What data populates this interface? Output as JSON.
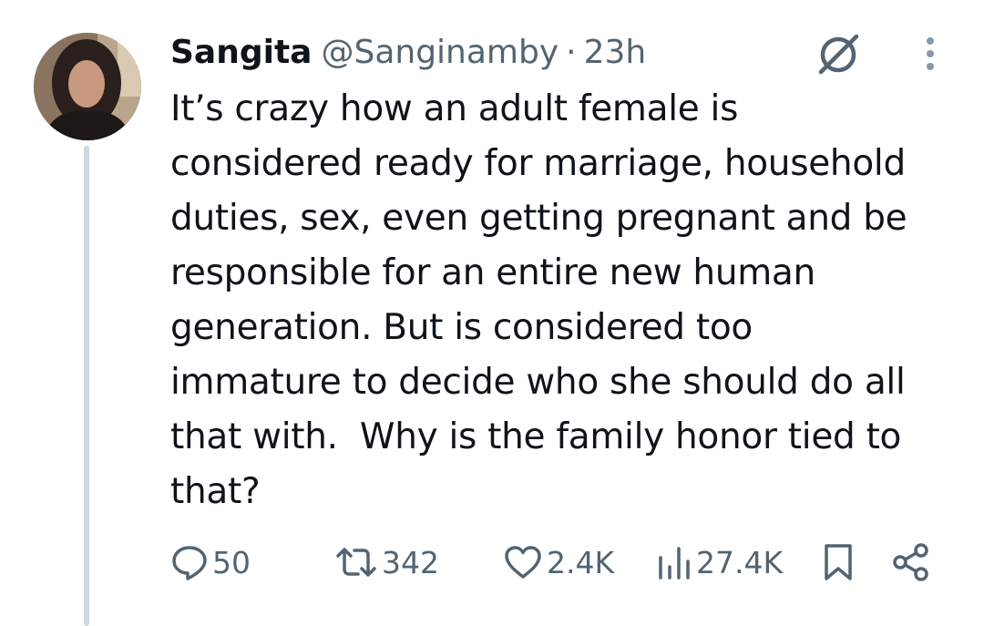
{
  "tweet": {
    "author": {
      "display_name": "Sangita",
      "handle": "@Sanginamby",
      "separator": "·",
      "time": "23h"
    },
    "text": "It’s crazy how an adult female is\nconsidered ready for marriage, household\nduties, sex, even getting pregnant and be\nresponsible for an entire new human\ngeneration. But is considered too\nimmature to decide who she should do all\nthat with.  Why is the family honor tied to\nthat?",
    "metrics": {
      "replies": "50",
      "reposts": "342",
      "likes": "2.4K",
      "views": "27.4K"
    }
  },
  "icons": {
    "reply": "speech-bubble-icon",
    "repost": "repost-arrows-icon",
    "like": "heart-icon",
    "views": "bar-chart-icon",
    "bookmark": "bookmark-icon",
    "share": "share-icon",
    "grok": "grok-slash-circle-icon",
    "more": "vertical-ellipsis-icon"
  },
  "colors": {
    "text_primary": "#0f1419",
    "text_secondary": "#536471",
    "thread_line": "#cfd9de",
    "background": "#ffffff"
  }
}
